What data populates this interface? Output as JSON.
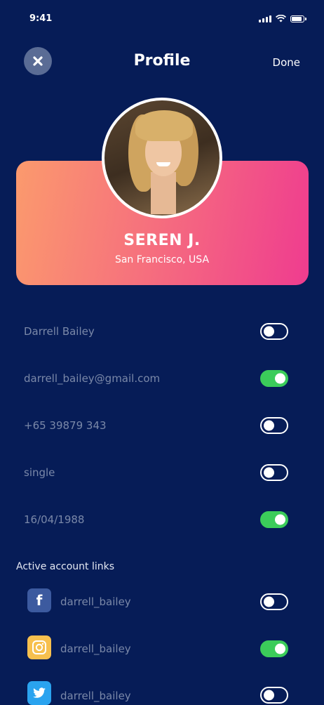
{
  "status_bar": {
    "time": "9:41"
  },
  "header": {
    "title": "Profile",
    "done_label": "Done"
  },
  "profile": {
    "name": "SEREN J.",
    "location": "San Francisco, USA"
  },
  "fields": [
    {
      "value": "Darrell Bailey",
      "enabled": false
    },
    {
      "value": "darrell_bailey@gmail.com",
      "enabled": true
    },
    {
      "value": "+65 39879 343",
      "enabled": false
    },
    {
      "value": "single",
      "enabled": false
    },
    {
      "value": "16/04/1988",
      "enabled": true
    }
  ],
  "links_section": {
    "title": "Active account links",
    "items": [
      {
        "icon": "facebook-icon",
        "handle": "darrell_bailey",
        "enabled": false
      },
      {
        "icon": "instagram-icon",
        "handle": "darrell_bailey",
        "enabled": true
      },
      {
        "icon": "twitter-icon",
        "handle": "darrell_bailey",
        "enabled": false
      }
    ]
  },
  "colors": {
    "background": "#061c57",
    "toggle_on": "#3bcc5a",
    "card_gradient_start": "#fb9a6d",
    "card_gradient_end": "#ef3c8f"
  }
}
